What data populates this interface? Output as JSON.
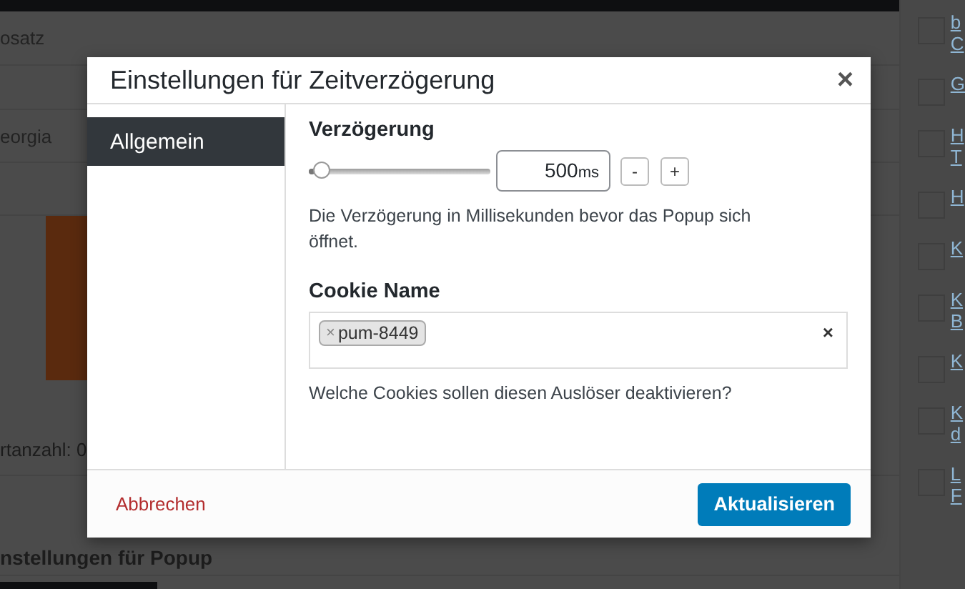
{
  "background": {
    "format_select": "osatz",
    "font_select": "eorgia",
    "word_count": "rtanzahl: 0",
    "panel_title": "nstellungen für Popup",
    "sidebar_links": [
      {
        "lines": [
          "b",
          "C"
        ],
        "checked": false
      },
      {
        "lines": [
          "G"
        ],
        "checked": false
      },
      {
        "lines": [
          "H",
          "T"
        ],
        "checked": false
      },
      {
        "lines": [
          "H"
        ],
        "checked": false
      },
      {
        "lines": [
          "K"
        ],
        "checked": false
      },
      {
        "lines": [
          "K",
          "B"
        ],
        "checked": false
      },
      {
        "lines": [
          "K"
        ],
        "checked": false
      },
      {
        "lines": [
          "K",
          "d"
        ],
        "checked": false
      },
      {
        "lines": [
          "L",
          "F"
        ],
        "checked": false
      }
    ]
  },
  "dialog": {
    "title": "Einstellungen für Zeitverzögerung",
    "close": "×",
    "tabs": [
      {
        "label": "Allgemein",
        "selected": true
      }
    ],
    "delay": {
      "label": "Verzögerung",
      "level": 0.08,
      "value": "500",
      "unit": "ms",
      "minus": "-",
      "plus": "+",
      "help": "Die Verzögerung in Millisekunden bevor das Popup sich öffnet."
    },
    "cookie": {
      "label": "Cookie Name",
      "tags": [
        {
          "remove": "×",
          "text": "pum-8449"
        }
      ],
      "clear": "×",
      "help": "Welche Cookies sollen diesen Auslöser deaktivieren?"
    },
    "cancel": "Abbrechen",
    "submit": "Aktualisieren"
  }
}
